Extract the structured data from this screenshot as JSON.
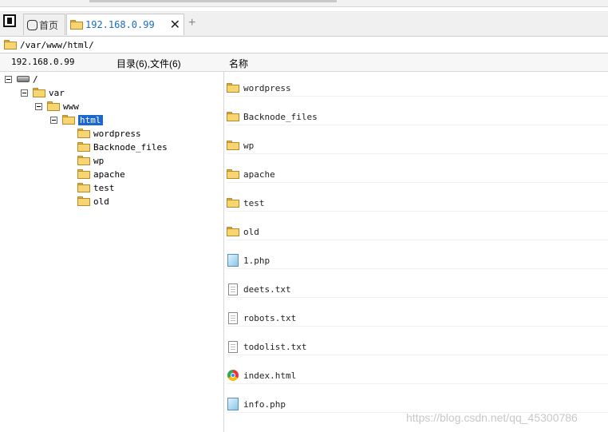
{
  "tabs": {
    "home_label": "首页",
    "active_label": "192.168.0.99",
    "close": "✕",
    "add": "+"
  },
  "path": "/var/www/html/",
  "header": {
    "host": "192.168.0.99",
    "summary": "目录(6),文件(6)",
    "name_col": "名称"
  },
  "tree": {
    "root": "/",
    "var": "var",
    "www": "www",
    "html": "html",
    "children": [
      "wordpress",
      "Backnode_files",
      "wp",
      "apache",
      "test",
      "old"
    ]
  },
  "files": [
    {
      "name": "wordpress",
      "icon": "folder"
    },
    {
      "name": "Backnode_files",
      "icon": "folder"
    },
    {
      "name": "wp",
      "icon": "folder"
    },
    {
      "name": "apache",
      "icon": "folder"
    },
    {
      "name": "test",
      "icon": "folder"
    },
    {
      "name": "old",
      "icon": "folder"
    },
    {
      "name": "1.php",
      "icon": "php"
    },
    {
      "name": "deets.txt",
      "icon": "txt"
    },
    {
      "name": "robots.txt",
      "icon": "txt"
    },
    {
      "name": "todolist.txt",
      "icon": "txt"
    },
    {
      "name": "index.html",
      "icon": "chrome"
    },
    {
      "name": "info.php",
      "icon": "php"
    }
  ],
  "watermark": "https://blog.csdn.net/qq_45300786"
}
